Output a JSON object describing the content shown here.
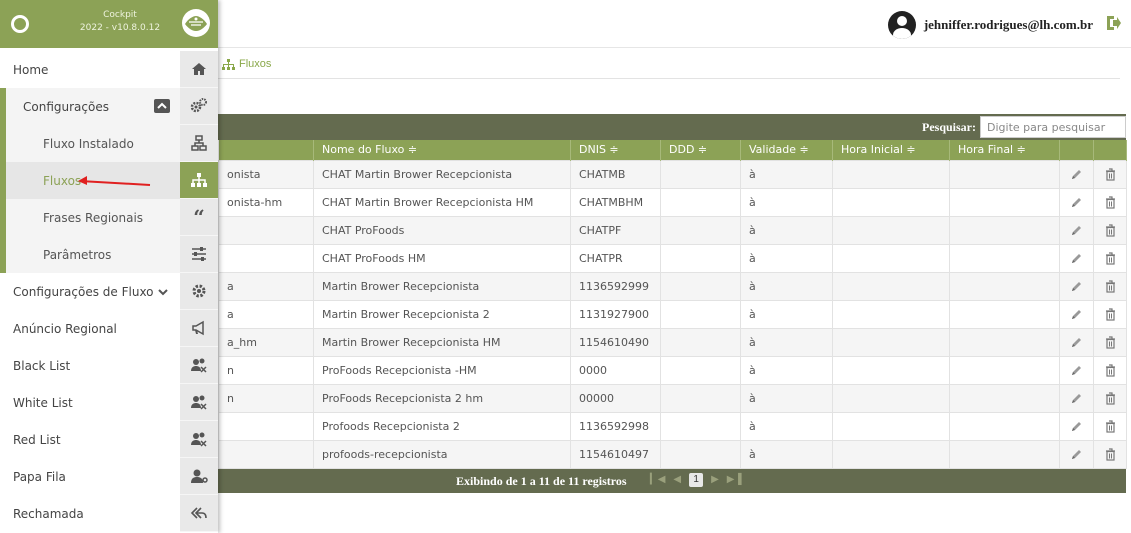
{
  "brand": {
    "name": "Cockpit",
    "version": "2022 - v10.8.0.12"
  },
  "user": {
    "email": "jehniffer.rodrigues@lh.com.br"
  },
  "breadcrumb": {
    "current": "Fluxos"
  },
  "menu": {
    "items": [
      {
        "label": "Home",
        "icon": "home-icon"
      },
      {
        "label": "Configurações",
        "icon": "gears-icon",
        "expanded": true
      },
      {
        "label": "Fluxo Instalado",
        "icon": "network-icon"
      },
      {
        "label": "Fluxos",
        "icon": "sitemap-icon",
        "active": true
      },
      {
        "label": "Frases Regionais",
        "icon": "quote-icon"
      },
      {
        "label": "Parâmetros",
        "icon": "sliders-icon"
      },
      {
        "label": "Configurações de Fluxo",
        "icon": "gear-icon"
      },
      {
        "label": "Anúncio Regional",
        "icon": "megaphone-icon"
      },
      {
        "label": "Black List",
        "icon": "users-block-icon"
      },
      {
        "label": "White List",
        "icon": "users-block-icon"
      },
      {
        "label": "Red List",
        "icon": "users-block-icon"
      },
      {
        "label": "Papa Fila",
        "icon": "user-queue-icon"
      },
      {
        "label": "Rechamada",
        "icon": "reply-all-icon"
      }
    ]
  },
  "search": {
    "label": "Pesquisar:",
    "placeholder": "Digite para pesquisar"
  },
  "table": {
    "columns": [
      "",
      "Nome do Fluxo ≑",
      "DNIS ≑",
      "DDD ≑",
      "Validade ≑",
      "Hora Inicial ≑",
      "Hora Final ≑"
    ],
    "rows": [
      {
        "c0": "onista",
        "nome": "CHAT Martin Brower Recepcionista",
        "dnis": "CHATMB",
        "ddd": "",
        "validade": "à",
        "hi": "",
        "hf": ""
      },
      {
        "c0": "onista-hm",
        "nome": "CHAT Martin Brower Recepcionista HM",
        "dnis": "CHATMBHM",
        "ddd": "",
        "validade": "à",
        "hi": "",
        "hf": ""
      },
      {
        "c0": "",
        "nome": "CHAT ProFoods",
        "dnis": "CHATPF",
        "ddd": "",
        "validade": "à",
        "hi": "",
        "hf": ""
      },
      {
        "c0": "",
        "nome": "CHAT ProFoods HM",
        "dnis": "CHATPR",
        "ddd": "",
        "validade": "à",
        "hi": "",
        "hf": ""
      },
      {
        "c0": "a",
        "nome": "Martin Brower Recepcionista",
        "dnis": "1136592999",
        "ddd": "",
        "validade": "à",
        "hi": "",
        "hf": ""
      },
      {
        "c0": "a",
        "nome": "Martin Brower Recepcionista 2",
        "dnis": "1131927900",
        "ddd": "",
        "validade": "à",
        "hi": "",
        "hf": ""
      },
      {
        "c0": "a_hm",
        "nome": "Martin Brower Recepcionista HM",
        "dnis": "1154610490",
        "ddd": "",
        "validade": "à",
        "hi": "",
        "hf": ""
      },
      {
        "c0": "n",
        "nome": "ProFoods Recepcionista -HM",
        "dnis": "0000",
        "ddd": "",
        "validade": "à",
        "hi": "",
        "hf": ""
      },
      {
        "c0": "n",
        "nome": "ProFoods Recepcionista 2 hm",
        "dnis": "00000",
        "ddd": "",
        "validade": "à",
        "hi": "",
        "hf": ""
      },
      {
        "c0": "",
        "nome": "Profoods Recepcionista 2",
        "dnis": "1136592998",
        "ddd": "",
        "validade": "à",
        "hi": "",
        "hf": ""
      },
      {
        "c0": "",
        "nome": "profoods-recepcionista",
        "dnis": "1154610497",
        "ddd": "",
        "validade": "à",
        "hi": "",
        "hf": ""
      }
    ]
  },
  "footer": {
    "info": "Exibindo de 1 a 11 de 11 registros",
    "page": "1"
  },
  "colors": {
    "accent": "#8ca256",
    "dark": "#646b4f",
    "arrow": "#e02020"
  }
}
